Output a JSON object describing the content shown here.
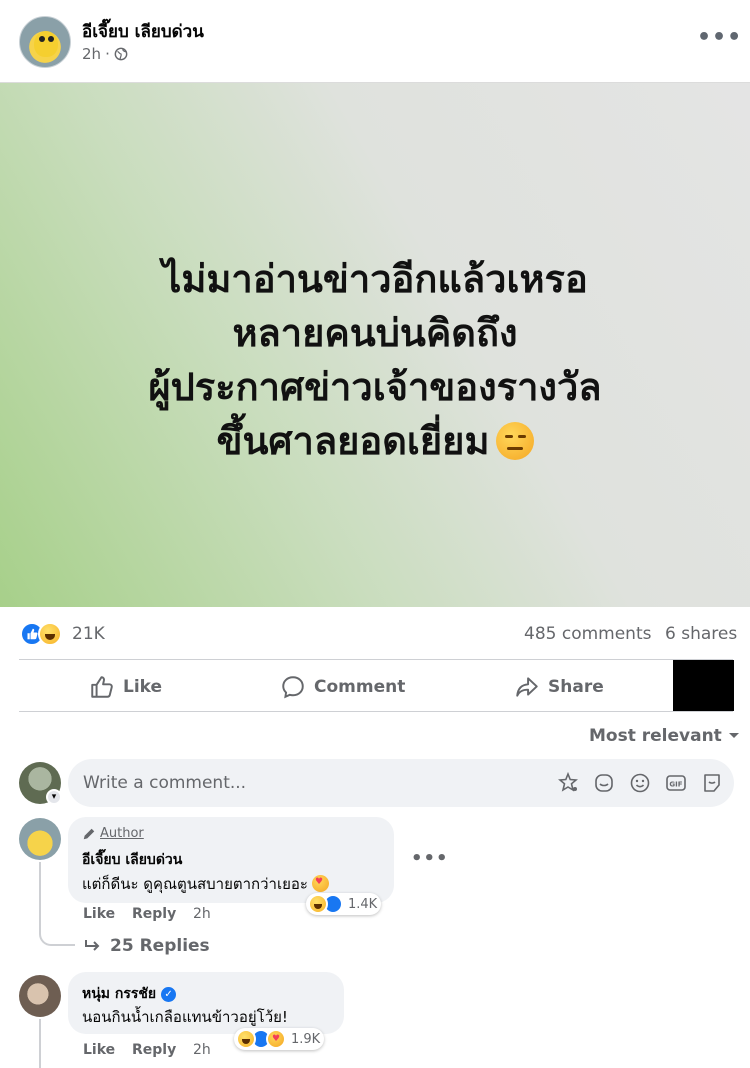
{
  "post": {
    "page_name": "อีเจี๊ยบ เลียบด่วน",
    "time": "2h",
    "separator": "·",
    "privacy_icon": "globe-icon",
    "more_icon": "•••",
    "image_text": {
      "line1": "ไม่มาอ่านข่าวอีกแล้วเหรอ",
      "line2": "หลายคนบ่นคิดถึง",
      "line3": "ผู้ประกาศข่าวเจ้าของรางวัล",
      "line4": "ขึ้นศาลยอดเยี่ยม"
    },
    "image_gradient": [
      "#a7d08a",
      "#e4e4e4"
    ]
  },
  "stats": {
    "reactions_count": "21K",
    "comments": "485 comments",
    "shares": "6 shares"
  },
  "actions": {
    "like": "Like",
    "comment": "Comment",
    "share": "Share"
  },
  "sort": {
    "label": "Most relevant"
  },
  "composer": {
    "placeholder": "Write a comment..."
  },
  "comments": [
    {
      "author_tag": "Author",
      "name": "อีเจี๊ยบ เลียบด่วน",
      "text": "แต่ก็ดีนะ ดูคุณตูนสบายตากว่าเยอะ",
      "like": "Like",
      "reply": "Reply",
      "time": "2h",
      "reactions": "1.4K",
      "replies": "25 Replies"
    },
    {
      "name": "หนุ่ม กรรชัย",
      "verified": true,
      "text": "นอนกินน้ำเกลือแทนข้าวอยู่โว้ย!",
      "like": "Like",
      "reply": "Reply",
      "time": "2h",
      "reactions": "1.9K"
    }
  ],
  "colors": {
    "accent": "#1877f2",
    "secondary_text": "#65676b",
    "bubble": "#f0f2f5"
  }
}
